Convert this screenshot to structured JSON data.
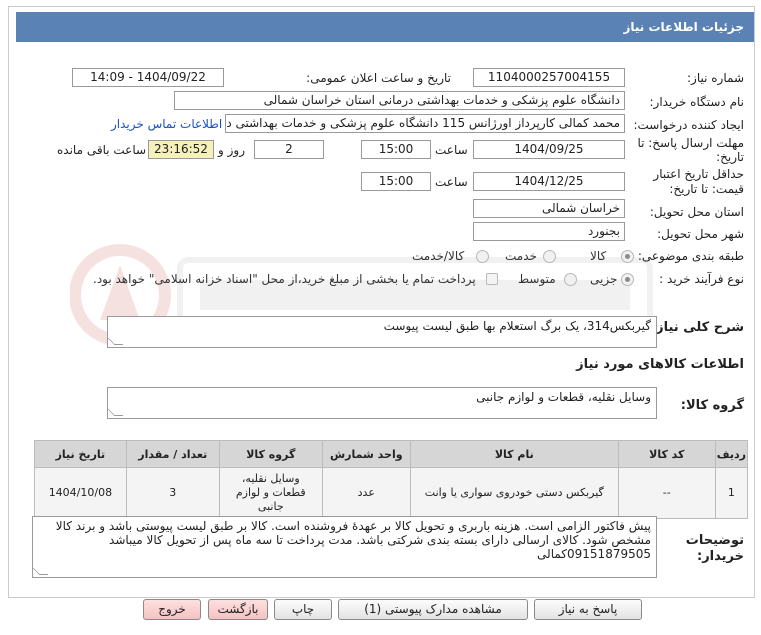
{
  "header": {
    "title": "جزئیات اطلاعات نیاز"
  },
  "form": {
    "need_number": {
      "label": "شماره نیاز:",
      "value": "1104000257004155"
    },
    "announce": {
      "label": "تاریخ و ساعت اعلان عمومی:",
      "value": "1404/09/22 - 14:09"
    },
    "buyer": {
      "label": "نام دستگاه خریدار:",
      "value": "دانشگاه علوم پزشکی و خدمات بهداشتی درمانی استان خراسان شمالی"
    },
    "creator": {
      "label": "ایجاد کننده درخواست:",
      "value": "محمد کمالی کارپرداز اورژانس 115 دانشگاه علوم پزشکی و خدمات بهداشتی در",
      "contact_link": "اطلاعات تماس خریدار"
    },
    "deadline": {
      "label_line1": "مهلت ارسال پاسخ: تا",
      "label_line2": "تاریخ:",
      "date": "1404/09/25",
      "time_label": "ساعت",
      "time": "15:00",
      "days": "2",
      "days_label": "روز و",
      "remaining": "23:16:52",
      "remaining_label": "ساعت باقی مانده"
    },
    "validity": {
      "label_line1": "حداقل تاریخ اعتبار",
      "label_line2": "قیمت: تا تاریخ:",
      "date": "1404/12/25",
      "time_label": "ساعت",
      "time": "15:00"
    },
    "province": {
      "label": "استان محل تحویل:",
      "value": "خراسان شمالی"
    },
    "city": {
      "label": "شهر محل تحویل:",
      "value": "بجنورد"
    },
    "category": {
      "label": "طبقه بندی موضوعی:",
      "options": [
        "کالا",
        "خدمت",
        "کالا/خدمت"
      ],
      "selected": "کالا"
    },
    "purchase_type": {
      "label": "نوع فرآیند خرید :",
      "options": [
        "جزیی",
        "متوسط"
      ],
      "selected": "جزیی",
      "payment_note": "پرداخت تمام یا بخشی از مبلغ خرید،از محل \"اسناد خزانه اسلامی\" خواهد بود."
    },
    "summary": {
      "label": "شرح کلی نیاز:",
      "value": "گیربکس314، یک برگ استعلام بها طبق لیست پیوست"
    },
    "goods_info_title": "اطلاعات کالاهای مورد نیاز",
    "goods_group": {
      "label": "گروه کالا:",
      "value": "وسایل نقلیه، قطعات و لوازم جانبی"
    }
  },
  "table": {
    "headers": [
      "ردیف",
      "کد کالا",
      "نام کالا",
      "واحد شمارش",
      "گروه کالا",
      "تعداد / مقدار",
      "تاریخ نیاز"
    ],
    "rows": [
      {
        "row": "1",
        "code": "--",
        "name": "گیربکس دستی خودروی سواری یا وانت",
        "unit": "عدد",
        "group": "وسایل نقلیه، قطعات و لوازم جانبی",
        "qty": "3",
        "date": "1404/10/08"
      }
    ]
  },
  "notes": {
    "label_line1": "توضیحات",
    "label_line2": "خریدار:",
    "value": "پیش فاکتور الزامی است. هزینه باربری و تحویل کالا بر عهدهٔ فروشنده است. کالا بر طبق لیست پیوستی باشد و برند کالا مشخص شود. کالای ارسالی دارای بسته بندی شرکتی باشد. مدت پرداخت تا سه ماه پس از تحویل کالا میباشد 09151879505کمالی"
  },
  "buttons": {
    "reply": "پاسخ به نیاز",
    "docs": "مشاهده مدارک پیوستی (1)",
    "print": "چاپ",
    "back": "بازگشت",
    "exit": "خروج"
  },
  "colors": {
    "header": "#5a82b4",
    "link": "#1a52c4",
    "remaining": "#f6f1b8",
    "exit": "#f5c2c2"
  }
}
